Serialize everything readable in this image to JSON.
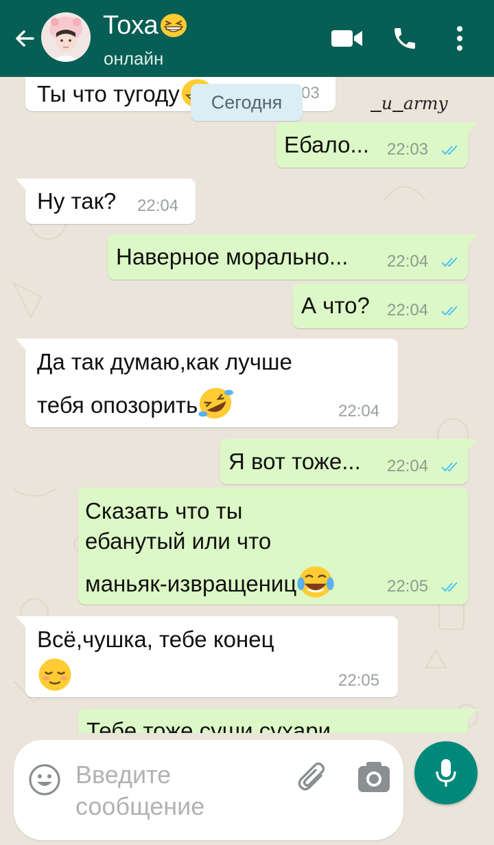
{
  "header": {
    "contact_name": "Тоха",
    "name_emoji_icon": "grinning-squinting-face",
    "status": "онлайн",
    "colors": {
      "bar": "#075e54",
      "text": "#ffffff"
    },
    "icons": {
      "back": "arrow-left-icon",
      "video": "video-camera-icon",
      "call": "phone-icon",
      "more": "more-vertical-icon"
    }
  },
  "chat": {
    "date_chip": "Сегодня",
    "watermark": "__и__army",
    "messages": [
      {
        "direction": "in",
        "text": "Ты что тугоду",
        "time": "03",
        "emoji": "grinning-squinting-face",
        "partially_hidden": true
      },
      {
        "direction": "out",
        "text": "Ебало...",
        "time": "22:03",
        "status": "read"
      },
      {
        "direction": "in",
        "text": "Ну так?",
        "time": "22:04"
      },
      {
        "direction": "out",
        "text": "Наверное морально...",
        "time": "22:04",
        "status": "read"
      },
      {
        "direction": "out",
        "text": "А что?",
        "time": "22:04",
        "status": "read"
      },
      {
        "direction": "in",
        "lines": [
          "Да так думаю,как лучше",
          "тебя опозорить"
        ],
        "time": "22:04",
        "emoji": "rolling-on-floor-laughing"
      },
      {
        "direction": "out",
        "text": "Я вот тоже...",
        "time": "22:04",
        "status": "read"
      },
      {
        "direction": "out",
        "lines": [
          "Сказать что ты",
          "ебанутый или что",
          "маньяк-извращениц"
        ],
        "time": "22:05",
        "status": "read",
        "emoji": "face-with-tears-of-joy"
      },
      {
        "direction": "in",
        "lines": [
          "Всё,чушка, тебе конец"
        ],
        "time": "22:05",
        "emoji": "relieved-face"
      },
      {
        "direction": "out",
        "text": "Тебе тоже суши сухари",
        "partially_hidden": true
      }
    ],
    "colors": {
      "incoming": "#ffffff",
      "outgoing": "#dcf8c6",
      "read_ticks": "#4fc3f7"
    }
  },
  "composer": {
    "placeholder": "Введите сообщение",
    "value": "",
    "icons": {
      "emoji": "smiley-icon",
      "attach": "paperclip-icon",
      "camera": "camera-icon",
      "mic": "microphone-icon"
    },
    "mic_color": "#00897b"
  }
}
